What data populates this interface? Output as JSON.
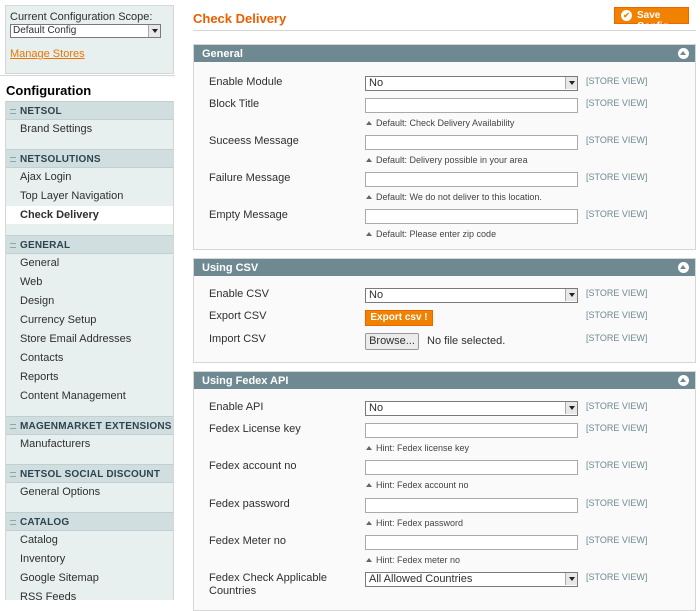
{
  "sidebar": {
    "scope_label": "Current Configuration Scope:",
    "scope_value": "Default Config",
    "manage_stores": "Manage Stores",
    "config_title": "Configuration",
    "groups": [
      {
        "head": "NETSOL",
        "items": [
          "Brand Settings"
        ]
      },
      {
        "head": "NETSOLUTIONS",
        "items": [
          "Ajax Login",
          "Top Layer Navigation",
          "Check Delivery"
        ]
      },
      {
        "head": "GENERAL",
        "items": [
          "General",
          "Web",
          "Design",
          "Currency Setup",
          "Store Email Addresses",
          "Contacts",
          "Reports",
          "Content Management"
        ]
      },
      {
        "head": "MAGENMARKET EXTENSIONS",
        "items": [
          "Manufacturers"
        ]
      },
      {
        "head": "NETSOL SOCIAL DISCOUNT",
        "items": [
          "General Options"
        ]
      },
      {
        "head": "CATALOG",
        "items": [
          "Catalog",
          "Inventory",
          "Google Sitemap",
          "RSS Feeds"
        ]
      }
    ],
    "active_item": "Check Delivery"
  },
  "main": {
    "title": "Check Delivery",
    "save_label": "Save Config",
    "store_view": "[STORE VIEW]",
    "general": {
      "title": "General",
      "enable_module": {
        "label": "Enable Module",
        "value": "No"
      },
      "block_title": {
        "label": "Block Title",
        "value": "",
        "note": "Default: Check Delivery Availability"
      },
      "success": {
        "label": "Suceess Message",
        "value": "",
        "note": "Default: Delivery possible in your area"
      },
      "failure": {
        "label": "Failure Message",
        "value": "",
        "note": "Default: We do not deliver to this location."
      },
      "empty": {
        "label": "Empty Message",
        "value": "",
        "note": "Default: Please enter zip code"
      }
    },
    "csv": {
      "title": "Using CSV",
      "enable_csv": {
        "label": "Enable CSV",
        "value": "No"
      },
      "export": {
        "label": "Export CSV",
        "button": "Export csv !"
      },
      "import": {
        "label": "Import CSV",
        "button": "Browse...",
        "file_text": "No file selected."
      }
    },
    "fedex": {
      "title": "Using Fedex API",
      "enable_api": {
        "label": "Enable API",
        "value": "No"
      },
      "license": {
        "label": "Fedex License key",
        "value": "",
        "note": "Hint: Fedex license key"
      },
      "account": {
        "label": "Fedex account no",
        "value": "",
        "note": "Hint: Fedex account no"
      },
      "password": {
        "label": "Fedex password",
        "value": "",
        "note": "Hint: Fedex password"
      },
      "meter": {
        "label": "Fedex Meter no",
        "value": "",
        "note": "Hint: Fedex meter no"
      },
      "countries": {
        "label": "Fedex Check Applicable Countries",
        "value": "All Allowed Countries"
      }
    }
  }
}
